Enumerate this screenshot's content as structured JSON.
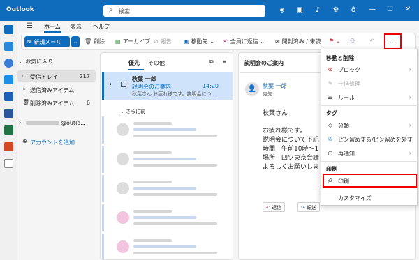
{
  "titlebar": {
    "app": "Outlook",
    "search_placeholder": "検索"
  },
  "nav": {
    "tabs": [
      "ホーム",
      "表示",
      "ヘルプ"
    ]
  },
  "ribbon": {
    "new_mail": "新規メール",
    "buttons": [
      {
        "label": "削除",
        "icon": "trash-icon"
      },
      {
        "label": "アーカイブ",
        "icon": "archive-icon"
      },
      {
        "label": "報告",
        "icon": "report-icon",
        "disabled": true
      },
      {
        "label": "移動先",
        "icon": "move-icon"
      },
      {
        "label": "全員に返信",
        "icon": "reply-all-icon"
      },
      {
        "label": "開封済み / 未読",
        "icon": "mail-read-icon"
      }
    ],
    "more": "..."
  },
  "folders": {
    "favorites": "お気に入り",
    "items": [
      {
        "label": "受信トレイ",
        "count": "217",
        "icon": "inbox-icon"
      },
      {
        "label": "送信済みアイテム",
        "count": "",
        "icon": "sent-icon"
      },
      {
        "label": "削除済みアイテム",
        "count": "6",
        "icon": "trash-icon"
      }
    ],
    "account": "@outlo...",
    "add_account": "アカウントを追加"
  },
  "list": {
    "tab_primary": "優先",
    "tab_other": "その他",
    "message": {
      "sender": "秋葉 一郎",
      "subject": "説明会のご案内",
      "time": "14:20",
      "preview": "秋葉さん お疲れ様です。説明会につ..."
    },
    "section": "さらに前"
  },
  "reading": {
    "subject": "説明会のご案内",
    "from": "秋葉 一郎",
    "to": "宛先:",
    "body": [
      "秋葉さん",
      "お疲れ様です。",
      "説明会について下記",
      "時間　午前10時～1",
      "場所　四ツ東京会議",
      "よろしくお願いしま"
    ],
    "reply": "返信",
    "forward": "転送"
  },
  "menu": {
    "section_move": "移動と削除",
    "block": "ブロック",
    "sweep": "一括処理",
    "rules": "ルール",
    "section_tags": "タグ",
    "categorize": "分類",
    "pin": "ピン留めする/ピン留めを外す",
    "snooze": "再通知",
    "section_print": "印刷",
    "print": "印刷",
    "customize": "カスタマイズ"
  },
  "colors": {
    "accent": "#0f6cbd",
    "highlight": "#ee0000"
  }
}
